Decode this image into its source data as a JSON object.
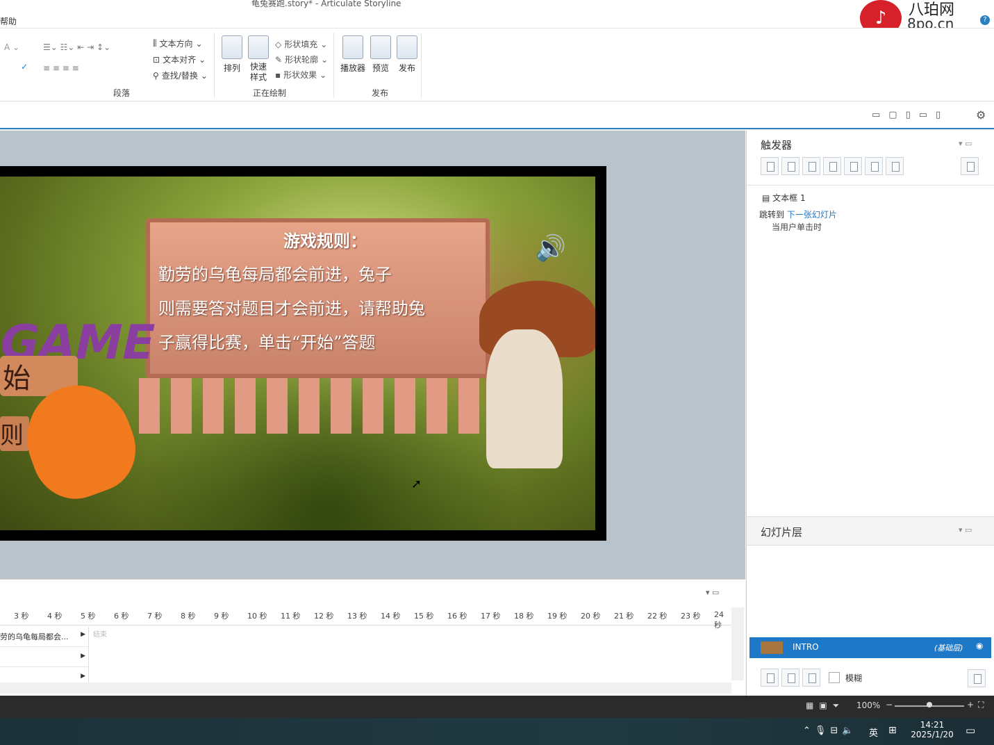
{
  "window": {
    "title": "龟兔赛跑.story* -  Articulate Storyline"
  },
  "ribbon": {
    "tab_fragment": "帮助",
    "groups": {
      "paragraph": {
        "label": "段落",
        "text_direction": "文本方向",
        "text_align": "文本对齐",
        "find_replace": "查找/替换"
      },
      "drawing": {
        "label": "正在绘制",
        "arrange": "排列",
        "quick_styles": "快速\n样式",
        "shape_fill": "形状填充",
        "shape_outline": "形状轮廓",
        "shape_effects": "形状效果"
      },
      "publish": {
        "label": "发布",
        "player": "播放器",
        "preview": "预览",
        "publish": "发布"
      }
    }
  },
  "slide": {
    "rules_title": "游戏规则：",
    "rules_line1": "勤劳的乌龟每局都会前进，兔子",
    "rules_line2": "则需要答对题目才会前进，请帮助兔",
    "rules_line3": "子赢得比赛，单击“开始”答题",
    "game_word": "GAME",
    "start_fragment": "始",
    "rules_fragment": "则"
  },
  "timeline": {
    "ticks": [
      "3 秒",
      "4 秒",
      "5 秒",
      "6 秒",
      "7 秒",
      "8 秒",
      "9 秒",
      "10 秒",
      "11 秒",
      "12 秒",
      "13 秒",
      "14 秒",
      "15 秒",
      "16 秒",
      "17 秒",
      "18 秒",
      "19 秒",
      "20 秒",
      "21 秒",
      "22 秒",
      "23 秒",
      "24 秒"
    ],
    "rows": [
      {
        "name": "劳的乌龟每局都会..."
      },
      {
        "name": ""
      },
      {
        "name": ""
      }
    ],
    "end_label": "结束"
  },
  "triggers": {
    "title": "触发器",
    "object": "文本框 1",
    "action_prefix": "跳转到",
    "action_target": "下一张幻灯片",
    "condition": "当用户单击时"
  },
  "layers": {
    "title": "幻灯片层",
    "base_layer": "INTRO",
    "base_tag": "(基础层)",
    "blur_label": "模糊"
  },
  "status": {
    "zoom": "100%"
  },
  "taskbar": {
    "ime": "英",
    "time": "14:21",
    "date": "2025/1/20"
  },
  "watermark": {
    "brand": "八珀网",
    "domain": "8po.cn"
  },
  "colors": {
    "accent": "#1e78c8",
    "statusbar": "#2b2b2b"
  }
}
